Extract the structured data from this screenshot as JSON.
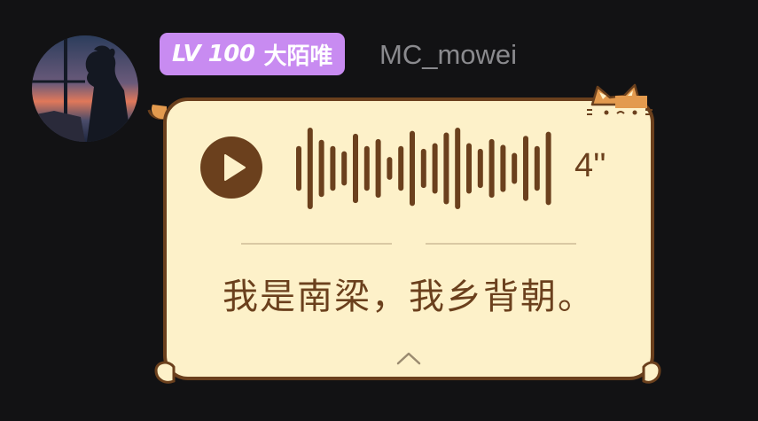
{
  "sender": {
    "level_label": "LV 100",
    "title": "大陌唯",
    "username": "MC_mowei"
  },
  "voice_message": {
    "duration": "4''",
    "transcript": "我是南梁，我乡背朝。",
    "waveform_levels": [
      0.55,
      1.0,
      0.7,
      0.55,
      0.42,
      0.85,
      0.55,
      0.72,
      0.28,
      0.55,
      0.92,
      0.48,
      0.62,
      0.88,
      1.0,
      0.62,
      0.48,
      0.72,
      0.58,
      0.38,
      0.8,
      0.55,
      0.9
    ]
  },
  "colors": {
    "background": "#121214",
    "badge": "#c88bf1",
    "bubble_fill": "#fdf1c9",
    "bubble_outline": "#6b401d",
    "cat_orange": "#e39a4e",
    "text_brown": "#6b401d",
    "username_gray": "#8a8a8e"
  },
  "icons": {
    "play": "play-icon",
    "collapse": "chevron-up-icon",
    "cat": "cat-ears-icon",
    "avatar": "avatar-silhouette"
  }
}
